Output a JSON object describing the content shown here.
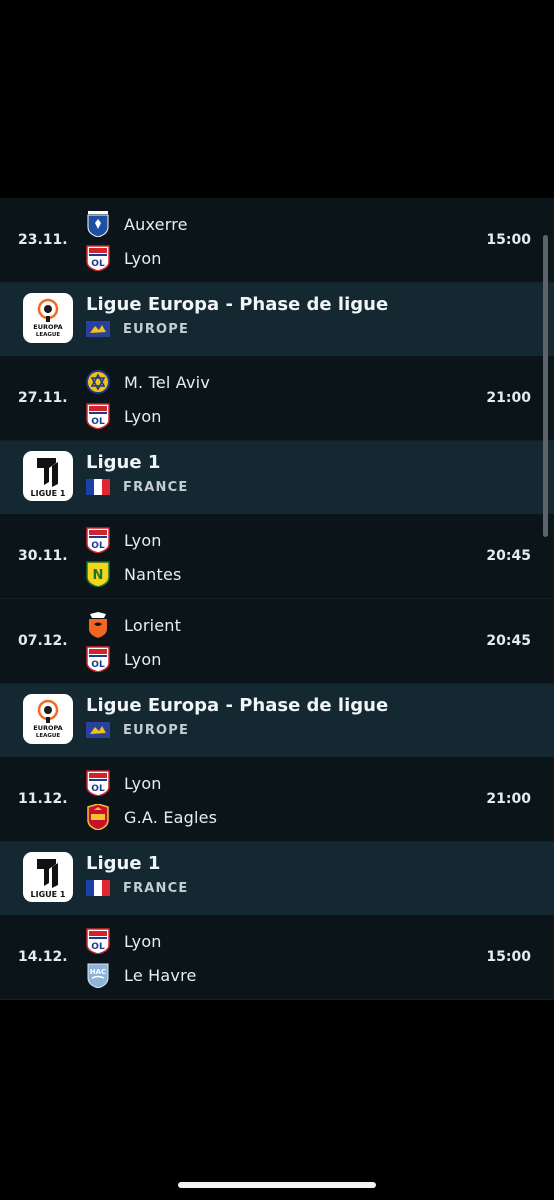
{
  "rows": [
    {
      "kind": "match",
      "date": "23.11.",
      "time": "15:00",
      "home": {
        "name": "Auxerre",
        "crest": "auxerre-crest-icon"
      },
      "away": {
        "name": "Lyon",
        "crest": "lyon-crest-icon"
      }
    },
    {
      "kind": "league",
      "name": "Ligue Europa - Phase de ligue",
      "logo": "europa-league-logo-icon",
      "country": "EUROPE",
      "flag": "europe-flag-icon"
    },
    {
      "kind": "match",
      "date": "27.11.",
      "time": "21:00",
      "home": {
        "name": "M. Tel Aviv",
        "crest": "maccabi-tel-aviv-crest-icon"
      },
      "away": {
        "name": "Lyon",
        "crest": "lyon-crest-icon"
      }
    },
    {
      "kind": "league",
      "name": "Ligue 1",
      "logo": "ligue-1-logo-icon",
      "country": "FRANCE",
      "flag": "france-flag-icon"
    },
    {
      "kind": "match",
      "date": "30.11.",
      "time": "20:45",
      "home": {
        "name": "Lyon",
        "crest": "lyon-crest-icon"
      },
      "away": {
        "name": "Nantes",
        "crest": "nantes-crest-icon"
      }
    },
    {
      "kind": "match",
      "date": "07.12.",
      "time": "20:45",
      "home": {
        "name": "Lorient",
        "crest": "lorient-crest-icon"
      },
      "away": {
        "name": "Lyon",
        "crest": "lyon-crest-icon"
      }
    },
    {
      "kind": "league",
      "name": "Ligue Europa - Phase de ligue",
      "logo": "europa-league-logo-icon",
      "country": "EUROPE",
      "flag": "europe-flag-icon"
    },
    {
      "kind": "match",
      "date": "11.12.",
      "time": "21:00",
      "home": {
        "name": "Lyon",
        "crest": "lyon-crest-icon"
      },
      "away": {
        "name": "G.A. Eagles",
        "crest": "go-ahead-eagles-crest-icon"
      }
    },
    {
      "kind": "league",
      "name": "Ligue 1",
      "logo": "ligue-1-logo-icon",
      "country": "FRANCE",
      "flag": "france-flag-icon"
    },
    {
      "kind": "match",
      "date": "14.12.",
      "time": "15:00",
      "home": {
        "name": "Lyon",
        "crest": "lyon-crest-icon"
      },
      "away": {
        "name": "Le Havre",
        "crest": "le-havre-crest-icon"
      }
    }
  ],
  "colors": {
    "background": "#000000",
    "match_row": "#0a1419",
    "league_row": "#132830",
    "text": "#e9eef2"
  }
}
